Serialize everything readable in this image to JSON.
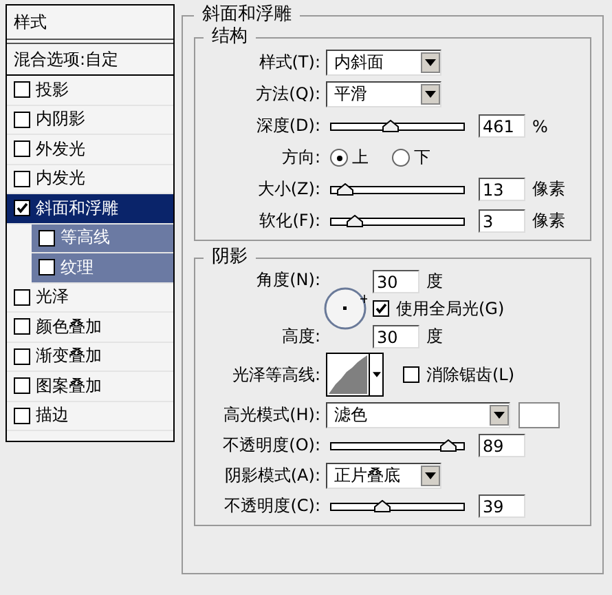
{
  "sidebar": {
    "title": "样式",
    "blend_options": "混合选项:自定",
    "items": [
      {
        "label": "投影",
        "checked": false,
        "selected": false
      },
      {
        "label": "内阴影",
        "checked": false,
        "selected": false
      },
      {
        "label": "外发光",
        "checked": false,
        "selected": false
      },
      {
        "label": "内发光",
        "checked": false,
        "selected": false
      },
      {
        "label": "斜面和浮雕",
        "checked": true,
        "selected": true,
        "children": [
          {
            "label": "等高线",
            "checked": false,
            "selected": false
          },
          {
            "label": "纹理",
            "checked": false,
            "selected": false
          }
        ]
      },
      {
        "label": "光泽",
        "checked": false,
        "selected": false
      },
      {
        "label": "颜色叠加",
        "checked": false,
        "selected": false
      },
      {
        "label": "渐变叠加",
        "checked": false,
        "selected": false
      },
      {
        "label": "图案叠加",
        "checked": false,
        "selected": false
      },
      {
        "label": "描边",
        "checked": false,
        "selected": false
      }
    ]
  },
  "panel": {
    "title": "斜面和浮雕",
    "structure": {
      "title": "结构",
      "rows": [
        {
          "kind": "select",
          "label": "样式(T):",
          "value": "内斜面"
        },
        {
          "kind": "select",
          "label": "方法(Q):",
          "value": "平滑"
        },
        {
          "kind": "slider",
          "label": "深度(D):",
          "level": 0.45,
          "value": "461",
          "unit": "%"
        },
        {
          "kind": "radio",
          "label": "方向:",
          "options": [
            {
              "label": "上",
              "selected": true
            },
            {
              "label": "下",
              "selected": false
            }
          ]
        },
        {
          "kind": "slider",
          "label": "大小(Z):",
          "level": 0.1,
          "value": "13",
          "unit": "像素"
        },
        {
          "kind": "slider",
          "label": "软化(F):",
          "level": 0.18,
          "value": "3",
          "unit": "像素"
        }
      ]
    },
    "shading": {
      "title": "阴影",
      "angle": {
        "label": "角度(N):",
        "value": "30",
        "unit": "度"
      },
      "global_light": {
        "label": "使用全局光(G)",
        "checked": true
      },
      "altitude": {
        "label": "高度:",
        "value": "30",
        "unit": "度"
      },
      "gloss": {
        "label": "光泽等高线:",
        "anti_alias": {
          "label": "消除锯齿(L)",
          "checked": false
        }
      },
      "rows": [
        {
          "kind": "select",
          "label": "高光模式(H):",
          "value": "滤色",
          "color": "#ffffff"
        },
        {
          "kind": "slider",
          "label": "不透明度(O):",
          "level": 0.89,
          "value": "89"
        },
        {
          "kind": "select",
          "label": "阴影模式(A):",
          "value": "正片叠底"
        },
        {
          "kind": "slider",
          "label": "不透明度(C):",
          "level": 0.39,
          "value": "39"
        }
      ]
    }
  }
}
